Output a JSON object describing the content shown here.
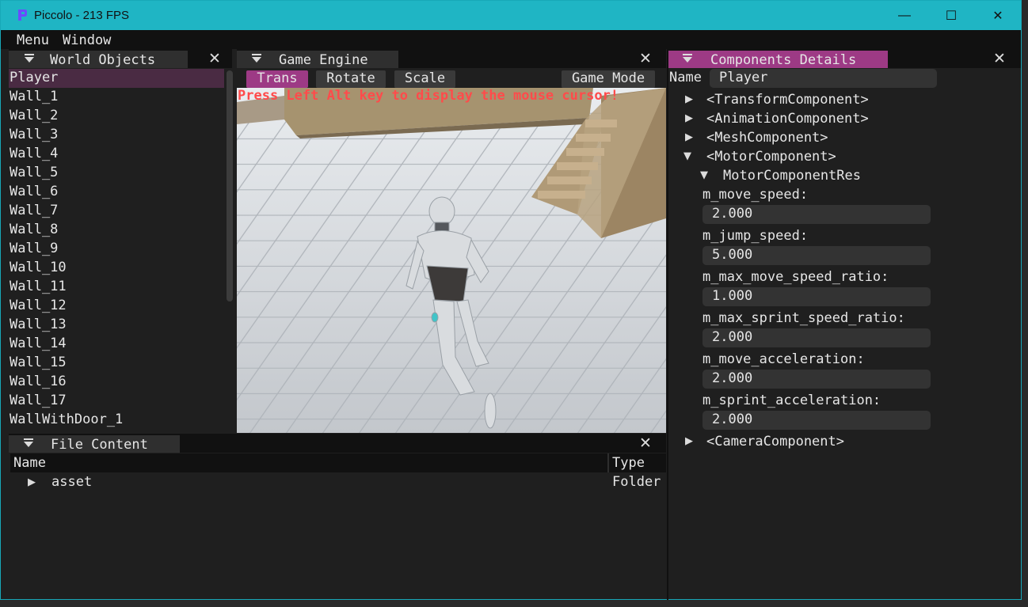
{
  "window": {
    "title": "Piccolo - 213 FPS",
    "minimize": "—",
    "maximize": "☐",
    "close": "✕"
  },
  "menubar": {
    "menu": "Menu",
    "window": "Window"
  },
  "world_objects": {
    "title": "World Objects",
    "items": [
      "Player",
      "Wall_1",
      "Wall_2",
      "Wall_3",
      "Wall_4",
      "Wall_5",
      "Wall_6",
      "Wall_7",
      "Wall_8",
      "Wall_9",
      "Wall_10",
      "Wall_11",
      "Wall_12",
      "Wall_13",
      "Wall_14",
      "Wall_15",
      "Wall_16",
      "Wall_17",
      "WallWithDoor_1"
    ],
    "selected": "Player"
  },
  "game_engine": {
    "title": "Game Engine",
    "buttons": {
      "trans": "Trans",
      "rotate": "Rotate",
      "scale": "Scale",
      "game_mode": "Game Mode"
    },
    "message": "Press Left Alt key to display the mouse cursor!"
  },
  "file_content": {
    "title": "File Content",
    "columns": {
      "name": "Name",
      "type": "Type"
    },
    "rows": [
      {
        "name": "asset",
        "type": "Folder"
      }
    ]
  },
  "components": {
    "title": "Components Details",
    "name_label": "Name",
    "name_value": "Player",
    "transform": "<TransformComponent>",
    "animation": "<AnimationComponent>",
    "mesh": "<MeshComponent>",
    "motor": "<MotorComponent>",
    "motor_res": "MotorComponentRes",
    "fields": [
      {
        "label": "m_move_speed:",
        "value": "2.000"
      },
      {
        "label": "m_jump_speed:",
        "value": "5.000"
      },
      {
        "label": "m_max_move_speed_ratio:",
        "value": "1.000"
      },
      {
        "label": "m_max_sprint_speed_ratio:",
        "value": "2.000"
      },
      {
        "label": "m_move_acceleration:",
        "value": "2.000"
      },
      {
        "label": "m_sprint_acceleration:",
        "value": "2.000"
      }
    ],
    "camera": "<CameraComponent>"
  },
  "colors": {
    "accent": "#9d3a85",
    "titlebar": "#1fb5c4",
    "warning": "#ff4b4b"
  },
  "icons": {
    "panel_menu": "triangle-down-icon",
    "close": "close-icon",
    "expand": "triangle-right-icon",
    "collapse": "triangle-down-icon"
  }
}
